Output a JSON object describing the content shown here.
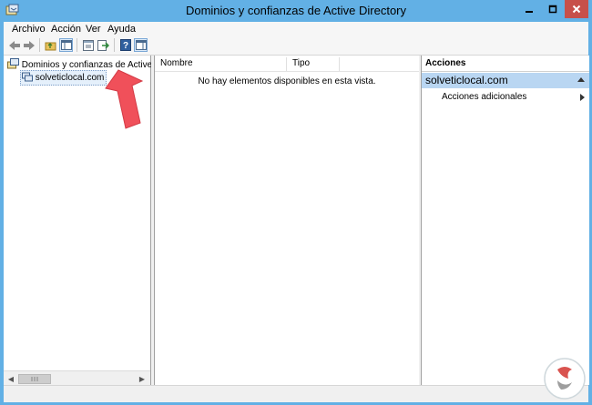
{
  "window": {
    "title": "Dominios y confianzas de Active Directory"
  },
  "menu": {
    "items": [
      "Archivo",
      "Acción",
      "Ver",
      "Ayuda"
    ]
  },
  "tree": {
    "root_label": "Dominios y confianzas de Active Di",
    "child_label": "solveticlocal.com"
  },
  "list": {
    "columns": [
      "Nombre",
      "Tipo"
    ],
    "empty_message": "No hay elementos disponibles en esta vista."
  },
  "actions": {
    "header": "Acciones",
    "group_label": "solveticlocal.com",
    "items": [
      "Acciones adicionales"
    ]
  },
  "colors": {
    "titlebar": "#62b0e5",
    "close_button": "#c7504a",
    "selection": "#b9d6f2",
    "annotation_arrow": "#f0505a"
  },
  "icons": [
    "back-icon",
    "forward-icon",
    "folder-up-icon",
    "console-tree-icon",
    "properties-icon",
    "export-icon",
    "help-icon",
    "action-pane-icon"
  ]
}
